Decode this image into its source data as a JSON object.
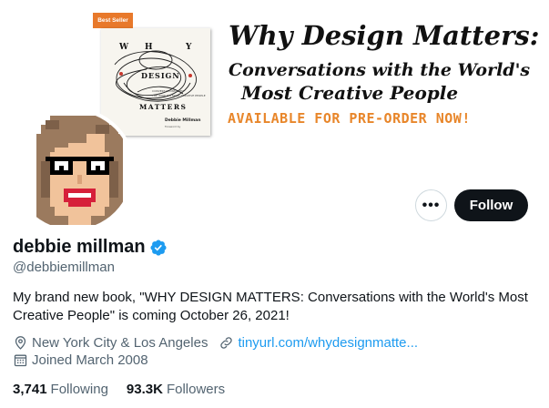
{
  "banner": {
    "badge": "Best Seller",
    "book": {
      "letter_w": "W",
      "letter_h": "H",
      "letter_y": "Y",
      "word_design": "DESIGN",
      "word_matters": "MATTERS",
      "small_line1": "CONVERSATIONS WITH",
      "small_line2": "THE WORLD'S MOST CREATIVE PEOPLE",
      "author": "Debbie Millman",
      "footnote": "Foreword by"
    },
    "headline_line1": "Why Design Matters:",
    "headline_line2": "Conversations with the World's",
    "headline_line3": "Most Creative People",
    "headline_line4": "AVAILABLE FOR PRE-ORDER NOW!"
  },
  "actions": {
    "more_label": "•••",
    "follow_label": "Follow"
  },
  "profile": {
    "display_name": "debbie millman",
    "handle": "@debbiemillman",
    "bio": "My brand new book, \"WHY DESIGN MATTERS: Conversations with the World's Most Creative People\" is coming October 26, 2021!",
    "location": "New York City & Los Angeles",
    "website": "tinyurl.com/whydesignmatte...",
    "joined": "Joined March 2008"
  },
  "stats": {
    "following_count": "3,741",
    "following_label": "Following",
    "followers_count": "93.3K",
    "followers_label": "Followers"
  },
  "colors": {
    "accent": "#1d9bf0",
    "primary_text": "#0f1419",
    "secondary_text": "#536471",
    "badge_orange": "#e8792b"
  }
}
